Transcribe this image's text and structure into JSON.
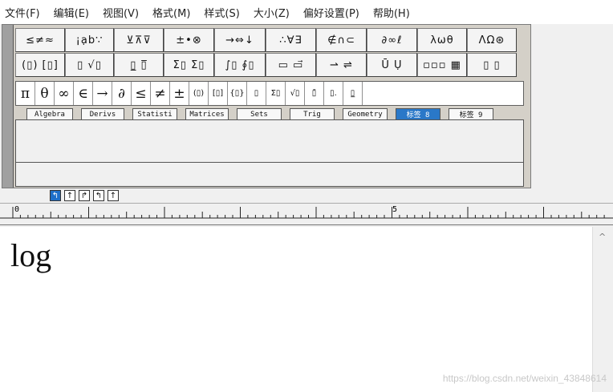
{
  "menu": [
    "文件(F)",
    "编辑(E)",
    "视图(V)",
    "格式(M)",
    "样式(S)",
    "大小(Z)",
    "偏好设置(P)",
    "帮助(H)"
  ],
  "symbol_row1": [
    "≤≠≈",
    "¡ạb∵",
    "⊻⊼⊽",
    "±•⊗",
    "→⇔↓",
    "∴∀∃",
    "∉∩⊂",
    "∂∞ℓ",
    "λωθ",
    "ΛΩ⊛"
  ],
  "symbol_row2": [
    "(▯) [▯]",
    "▯ √▯",
    "▯̲ ▯̅",
    "Σ▯ Σ▯",
    "∫▯ ∮▯",
    "▭ ▭⃗",
    "⇀ ⇌",
    "Ū Ụ",
    "▫▫▫ ▦",
    "▯ ▯"
  ],
  "small_bar": [
    "π",
    "θ",
    "∞",
    "∈",
    "→",
    "∂",
    "≤",
    "≠",
    "±",
    "(▯)",
    "[▯]",
    "{▯}",
    "▯",
    "Σ▯",
    "√▯",
    "▯̄",
    "▯.",
    "▯̲"
  ],
  "tabs": [
    "Algebra",
    "Derivs",
    "Statisti",
    "Matrices",
    "Sets",
    "Trig",
    "Geometry",
    "标签 8",
    "标签 9"
  ],
  "active_tab": 7,
  "align_buttons": [
    "↰",
    "↑",
    "↱",
    "↰",
    "↑"
  ],
  "ruler": {
    "label_0": "0",
    "label_5": "5"
  },
  "editor": {
    "equation": "log"
  },
  "scrollbar": {
    "up_arrow": "^"
  },
  "watermark": "https://blog.csdn.net/weixin_43848614",
  "colors": {
    "active_tab": "#2a78c8",
    "palette_bg": "#d4d0c8"
  }
}
